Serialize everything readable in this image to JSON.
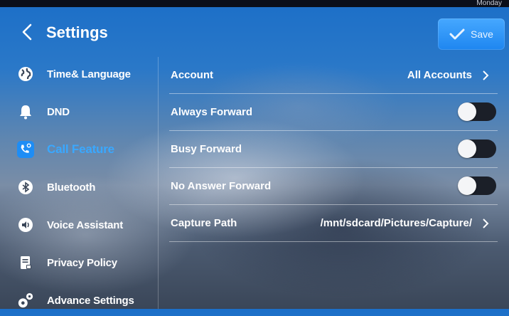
{
  "header": {
    "title": "Settings",
    "save_label": "Save",
    "strip_text": "Monday"
  },
  "sidebar": {
    "items": [
      {
        "label": "Time& Language",
        "icon": "globe-icon"
      },
      {
        "label": "DND",
        "icon": "bell-icon"
      },
      {
        "label": "Call Feature",
        "icon": "call-settings-icon",
        "active": true
      },
      {
        "label": "Bluetooth",
        "icon": "bluetooth-icon"
      },
      {
        "label": "Voice Assistant",
        "icon": "speaker-icon"
      },
      {
        "label": "Privacy Policy",
        "icon": "document-lock-icon"
      },
      {
        "label": "Advance Settings",
        "icon": "gears-icon"
      }
    ]
  },
  "settings": {
    "account": {
      "label": "Account",
      "value": "All Accounts"
    },
    "always_forward": {
      "label": "Always Forward",
      "on": false
    },
    "busy_forward": {
      "label": "Busy Forward",
      "on": false
    },
    "no_answer_forward": {
      "label": "No Answer Forward",
      "on": false
    },
    "capture_path": {
      "label": "Capture Path",
      "value": "/mnt/sdcard/Pictures/Capture/"
    }
  },
  "colors": {
    "accent": "#3aa8ff",
    "save_button": "#2b93f5",
    "toggle_track": "#1b1f28"
  }
}
